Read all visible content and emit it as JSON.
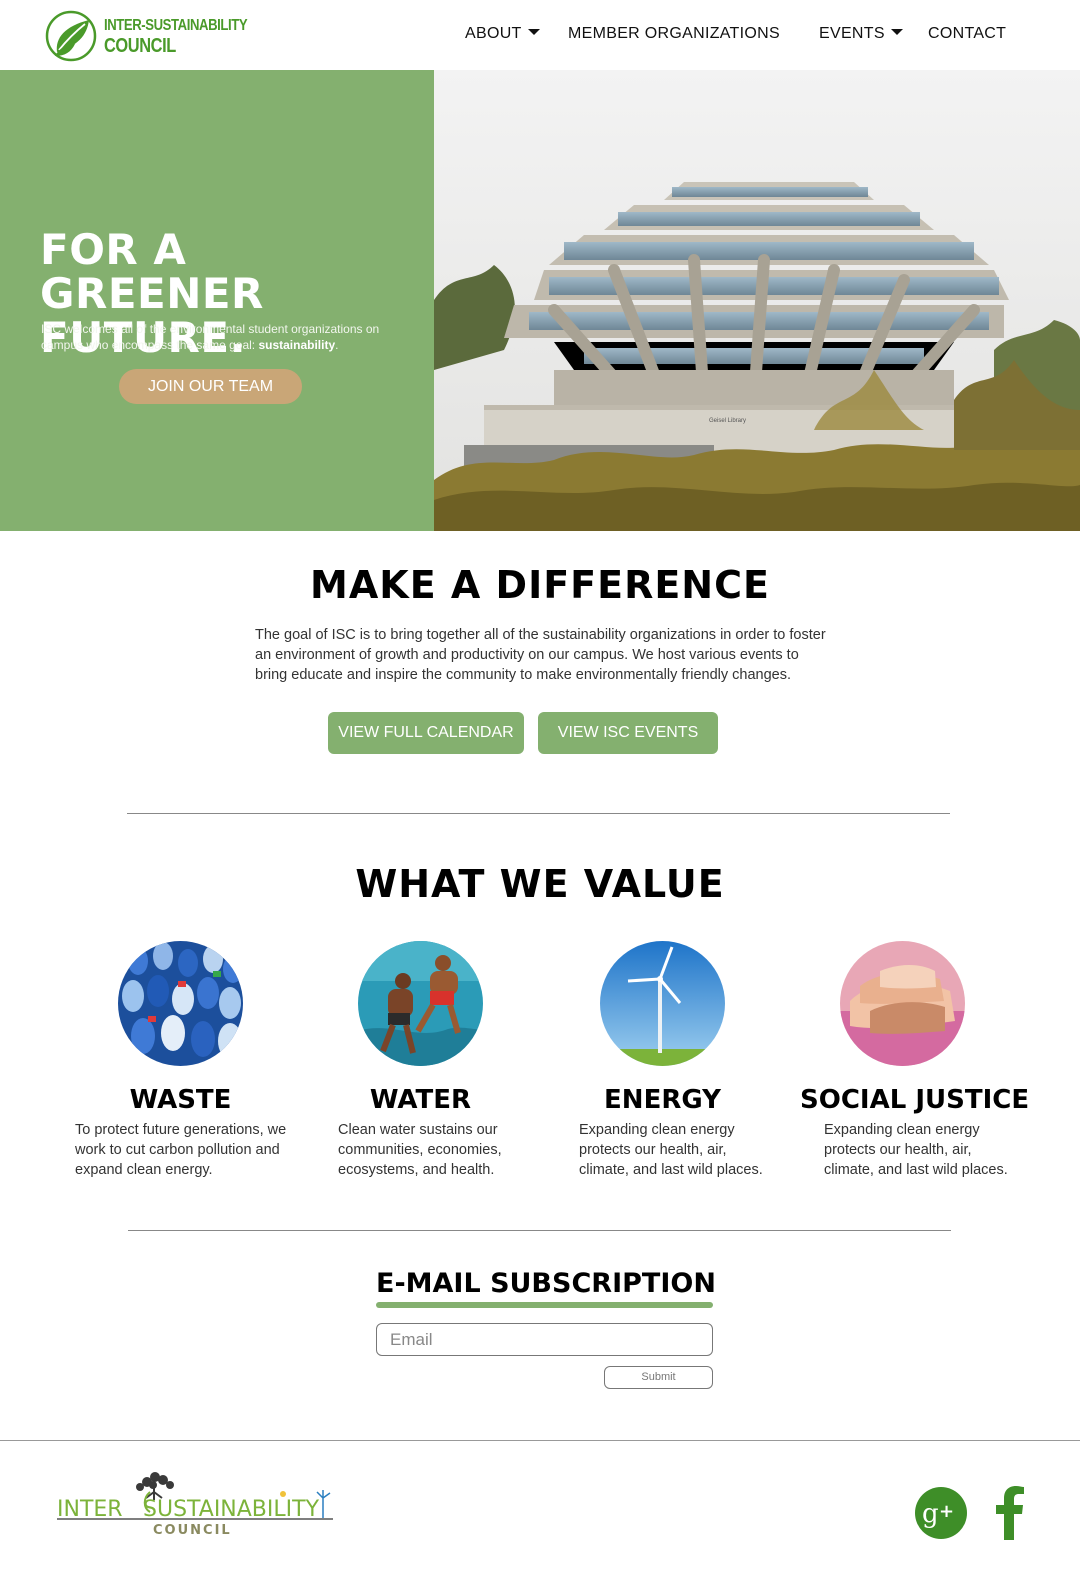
{
  "nav": {
    "logo": {
      "line1": "INTER-SUSTAINABILITY",
      "line2": "COUNCIL"
    },
    "items": [
      {
        "label": "ABOUT",
        "dropdown": true
      },
      {
        "label": "MEMBER ORGANIZATIONS",
        "dropdown": false
      },
      {
        "label": "EVENTS",
        "dropdown": true
      },
      {
        "label": "CONTACT",
        "dropdown": false
      }
    ]
  },
  "hero": {
    "title": "FOR A GREENER FUTURE.",
    "subtitle_prefix": "ISC welcomes all of the environmental student organizations on campus who encompass the same goal: ",
    "subtitle_bold": "sustainability",
    "subtitle_suffix": ".",
    "cta": "JOIN OUR TEAM",
    "image_sign": "Geisel Library"
  },
  "difference": {
    "title": "MAKE A DIFFERENCE",
    "text": "The goal of ISC is to bring together all of the sustainability organizations in order to foster an environment of growth and productivity on our campus. We host various events to bring educate and inspire the community to make environmentally friendly changes.",
    "buttons": [
      "VIEW FULL CALENDAR",
      "VIEW ISC EVENTS"
    ]
  },
  "values": {
    "title": "WHAT WE VALUE",
    "items": [
      {
        "name": "WASTE",
        "desc": "To protect future generations, we work to cut carbon pollution and expand clean energy."
      },
      {
        "name": "WATER",
        "desc": "Clean water sustains our communities, economies, ecosystems, and health."
      },
      {
        "name": "ENERGY",
        "desc": "Expanding clean energy protects our health, air, climate, and last wild places."
      },
      {
        "name": "SOCIAL JUSTICE",
        "desc": "Expanding clean energy protects our health, air, climate, and last wild places."
      }
    ]
  },
  "subscription": {
    "title": "E-MAIL SUBSCRIPTION",
    "placeholder": "Email",
    "submit": "Submit"
  },
  "footer": {
    "logo_word1": "INTER",
    "logo_word2": "SUSTAINABILITY",
    "logo_word3": "COUNCIL",
    "social": [
      "google-plus-icon",
      "facebook-icon"
    ]
  },
  "colors": {
    "green": "#84b06f",
    "tan": "#c9a677",
    "logo_green": "#4a9a2a"
  }
}
